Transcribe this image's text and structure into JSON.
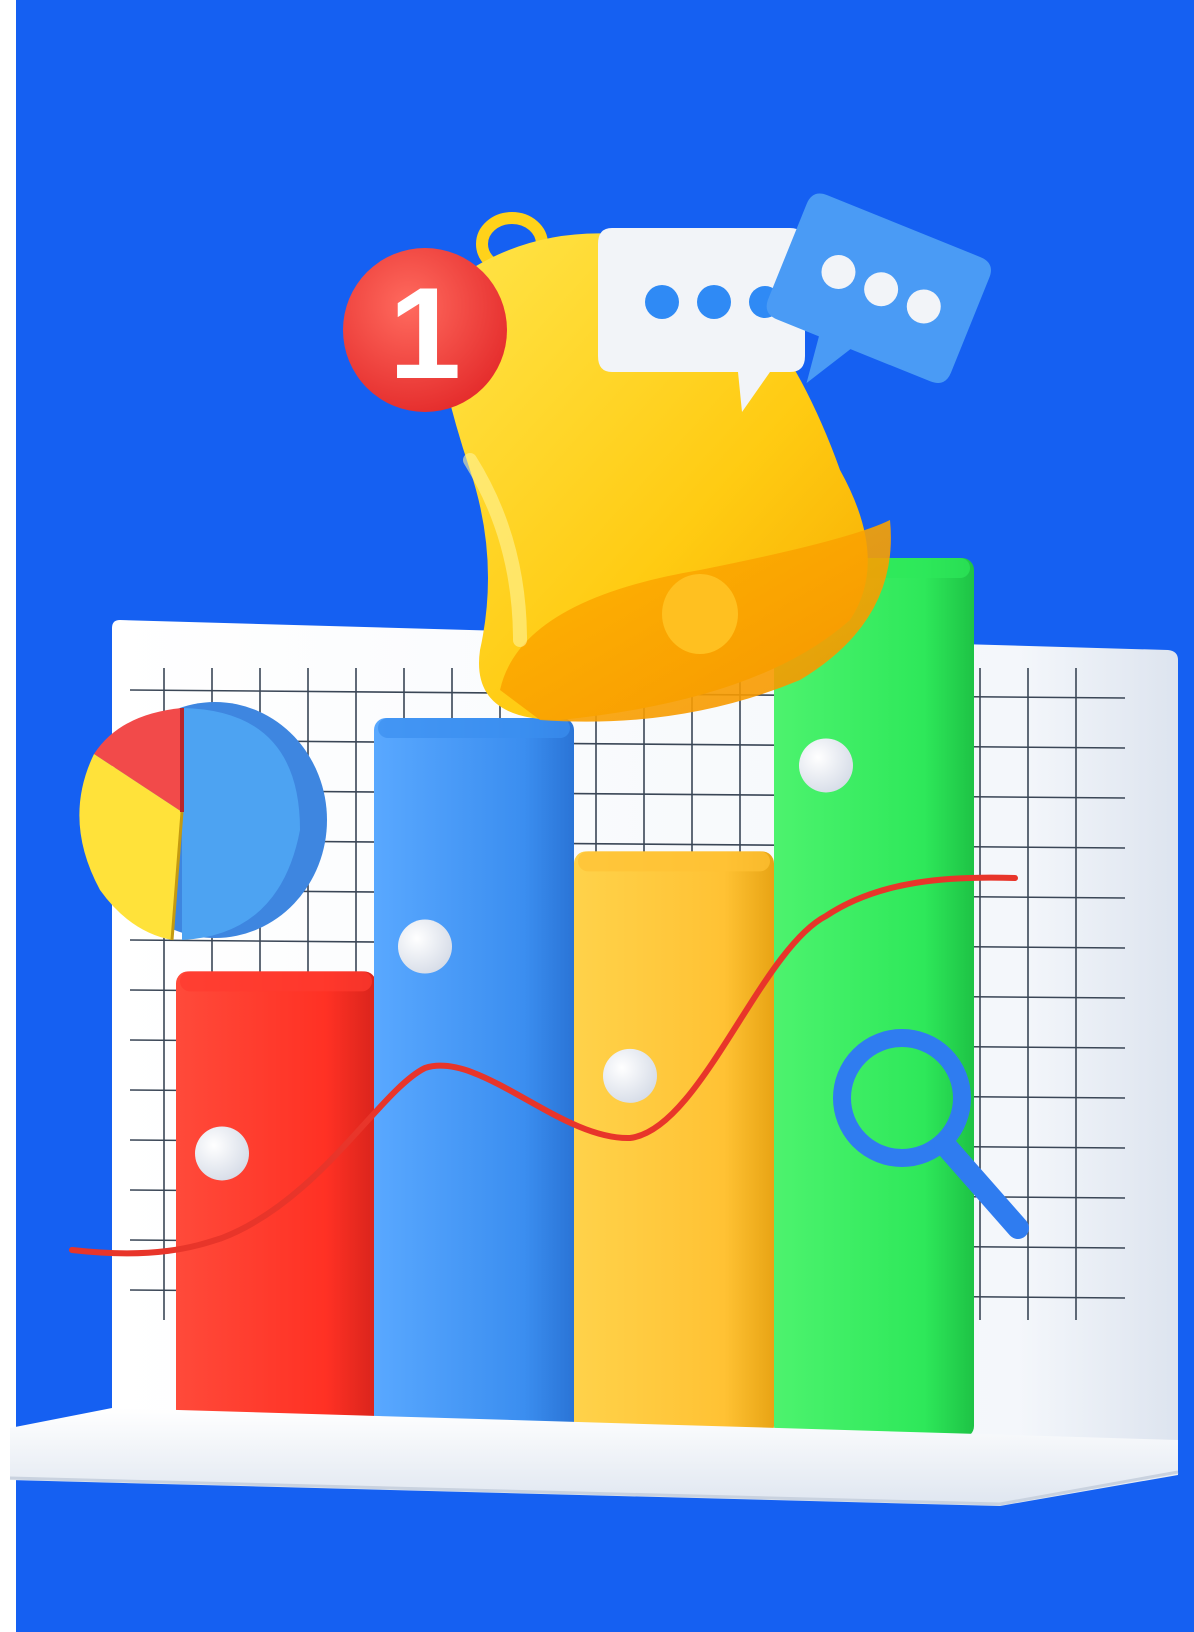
{
  "notification_badge": {
    "count": "1"
  },
  "colors": {
    "background": "#1560F2",
    "board": "#FFFFFF",
    "grid": "#3A4656",
    "bar_red": "#FF3B2F",
    "bar_blue": "#3B8EF0",
    "bar_yellow": "#FFC234",
    "bar_green": "#2EE85A",
    "trend_line": "#E8352A",
    "bell": "#FFD21A",
    "badge": "#F23D3D",
    "bubble_white": "#F2F4F8",
    "bubble_blue": "#4A9BF5",
    "magnifier": "#2F7CF0"
  },
  "chart_data": {
    "type": "bar",
    "categories": [
      "",
      "",
      "",
      ""
    ],
    "values": [
      35,
      54,
      44,
      66
    ],
    "series": [
      {
        "values": [
          35,
          54,
          44,
          66
        ]
      }
    ],
    "trend_line": {
      "values": [
        22,
        38,
        28,
        52
      ]
    },
    "ylim": [
      0,
      75
    ],
    "grid": true,
    "title": "",
    "xlabel": "",
    "ylabel": ""
  },
  "pie_chart": {
    "slices": [
      {
        "value": 48,
        "color": "#4DA3F2"
      },
      {
        "value": 32,
        "color": "#FFE23A"
      },
      {
        "value": 20,
        "color": "#F24A4A"
      }
    ]
  },
  "icons": [
    "bell-icon",
    "chat-bubble-icon",
    "magnifier-icon",
    "pie-chart-icon"
  ]
}
